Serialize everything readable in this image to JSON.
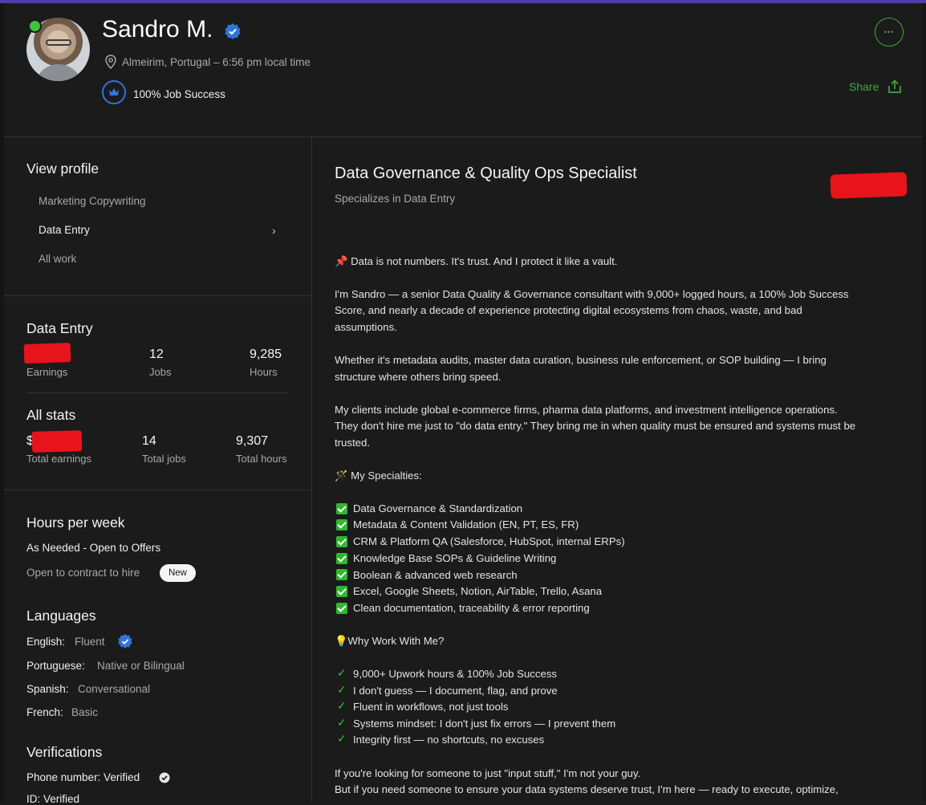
{
  "profile": {
    "name": "Sandro M.",
    "location": "Almeirim, Portugal – 6:56 pm local time",
    "job_success": "100% Job Success",
    "share_label": "Share",
    "more_label": "•••"
  },
  "sidebar": {
    "view_profile_title": "View profile",
    "nav": [
      "Marketing Copywriting",
      "Data Entry",
      "All work"
    ],
    "data_entry": {
      "title": "Data Entry",
      "stats": [
        {
          "value": "",
          "label": "Earnings"
        },
        {
          "value": "12",
          "label": "Jobs"
        },
        {
          "value": "9,285",
          "label": "Hours"
        }
      ]
    },
    "all_stats": {
      "title": "All stats",
      "stats": [
        {
          "value": "$",
          "label": "Total earnings"
        },
        {
          "value": "14",
          "label": "Total jobs"
        },
        {
          "value": "9,307",
          "label": "Total hours"
        }
      ]
    },
    "hours": {
      "title": "Hours per week",
      "availability": "As Needed - Open to Offers",
      "contract": "Open to contract to hire",
      "new_badge": "New"
    },
    "languages": {
      "title": "Languages",
      "items": [
        {
          "name": "English:",
          "level": "Fluent"
        },
        {
          "name": "Portuguese:",
          "level": "Native or Bilingual"
        },
        {
          "name": "Spanish:",
          "level": "Conversational"
        },
        {
          "name": "French:",
          "level": "Basic"
        }
      ]
    },
    "verifications": {
      "title": "Verifications",
      "items": [
        "Phone number: Verified",
        "ID: Verified"
      ]
    }
  },
  "main": {
    "title": "Data Governance & Quality Ops Specialist",
    "subtitle": "Specializes in Data Entry",
    "intro": "📌 Data is not numbers. It's trust. And I protect it like a vault.",
    "para1": [
      "I'm Sandro — a senior Data Quality & Governance consultant with 9,000+ logged hours, a 100% Job Success",
      "Score, and nearly a decade of experience protecting digital ecosystems from chaos, waste, and bad",
      "assumptions."
    ],
    "para2": [
      "Whether it's metadata audits, master data curation, business rule enforcement, or SOP building — I bring",
      "structure where others bring speed."
    ],
    "para3": [
      "My clients include global e-commerce firms, pharma data platforms, and investment intelligence operations.",
      "They don't hire me just to \"do data entry.\" They bring me in when quality must be ensured and systems must be",
      "trusted."
    ],
    "specialties_heading": "🪄 My Specialties:",
    "specialties": [
      "Data Governance & Standardization",
      "Metadata & Content Validation (EN, PT, ES, FR)",
      "CRM & Platform QA (Salesforce, HubSpot, internal ERPs)",
      "Knowledge Base SOPs & Guideline Writing",
      "Boolean & advanced web research",
      "Excel, Google Sheets, Notion, AirTable, Trello, Asana",
      "Clean documentation, traceability & error reporting"
    ],
    "why_heading": "💡Why Work With Me?",
    "why": [
      "9,000+ Upwork hours & 100% Job Success",
      "I don't guess — I document, flag, and prove",
      "Fluent in workflows, not just tools",
      "Systems mindset: I don't just fix errors — I prevent them",
      "Integrity first — no shortcuts, no excuses"
    ],
    "closing": [
      "If you're looking for someone to just \"input stuff,\" I'm not your guy.",
      "But if you need someone to ensure your data systems deserve trust, I'm here — ready to execute, optimize,"
    ]
  },
  "colors": {
    "accent_green": "#3ea83e",
    "verified_blue": "#2f75d9",
    "redaction": "#e8141c",
    "background": "#1b1b1c"
  },
  "icons": [
    "location-pin-icon",
    "verified-icon",
    "crown-icon",
    "more-icon",
    "share-icon",
    "chevron-right-icon",
    "check-icon"
  ]
}
